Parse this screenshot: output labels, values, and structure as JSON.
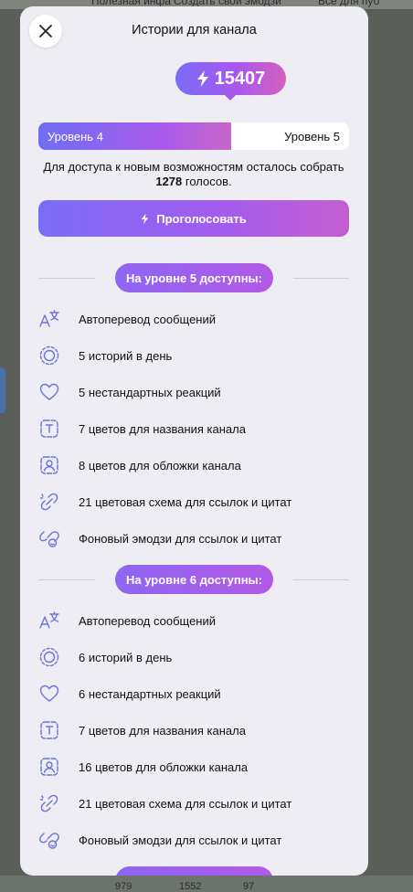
{
  "background": {
    "top_text": [
      "Полезная инфа",
      "Создать свой эмодзи",
      "Всё для пуб"
    ],
    "bottom_text": [
      "979",
      "1552",
      "97"
    ]
  },
  "modal": {
    "title": "Истории для канала",
    "votes": "15407",
    "progress": {
      "current_level": "Уровень 4",
      "next_level": "Уровень 5",
      "fill_fraction": 0.62
    },
    "info_prefix": "Для доступа к новым возможностям осталось собрать",
    "info_count": "1278",
    "info_suffix": "голосов.",
    "vote_button": "Проголосовать",
    "colors": {
      "accent_start": "#7a6cf5",
      "accent_end": "#c45ed0",
      "icon": "#6b73d8",
      "panel_bg": "#eeedf3"
    },
    "sections": [
      {
        "heading": "На уровне 5 доступны:",
        "features": [
          {
            "icon": "translate-icon",
            "label": "Автоперевод сообщений"
          },
          {
            "icon": "stories-icon",
            "label": "5 историй в день"
          },
          {
            "icon": "heart-icon",
            "label": "5 нестандартных реакций"
          },
          {
            "icon": "name-color-icon",
            "label": "7 цветов для названия канала"
          },
          {
            "icon": "cover-color-icon",
            "label": "8 цветов для обложки канала"
          },
          {
            "icon": "link-color-icon",
            "label": "21 цветовая схема для ссылок и цитат"
          },
          {
            "icon": "emoji-background-icon",
            "label": "Фоновый эмодзи для ссылок и цитат"
          }
        ]
      },
      {
        "heading": "На уровне 6 доступны:",
        "features": [
          {
            "icon": "translate-icon",
            "label": "Автоперевод сообщений"
          },
          {
            "icon": "stories-icon",
            "label": "6 историй в день"
          },
          {
            "icon": "heart-icon",
            "label": "6 нестандартных реакций"
          },
          {
            "icon": "name-color-icon",
            "label": "7 цветов для названия канала"
          },
          {
            "icon": "cover-color-icon",
            "label": "16 цветов для обложки канала"
          },
          {
            "icon": "link-color-icon",
            "label": "21 цветовая схема для ссылок и цитат"
          },
          {
            "icon": "emoji-background-icon",
            "label": "Фоновый эмодзи для ссылок и цитат"
          }
        ]
      }
    ]
  }
}
